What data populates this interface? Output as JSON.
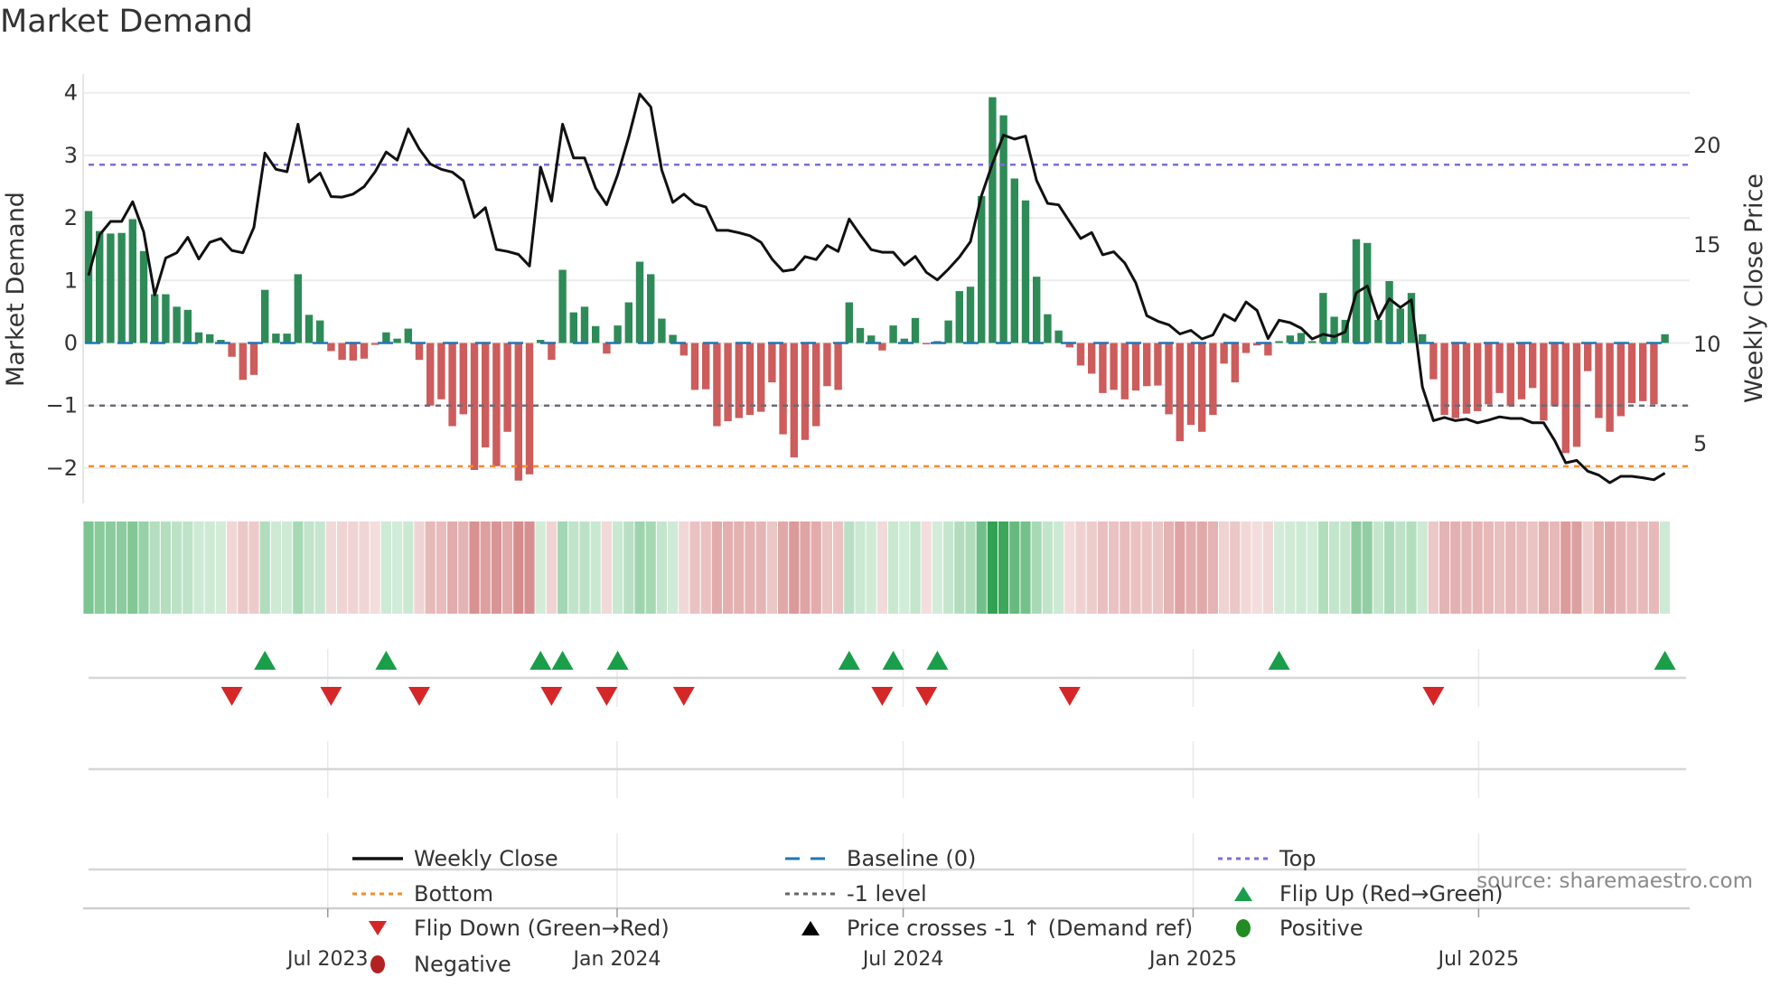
{
  "title": "Market Demand",
  "source": "source: sharemaestro.com",
  "legend": {
    "items": [
      {
        "label": "Weekly Close",
        "symbol": "line-solid",
        "color": "#111111"
      },
      {
        "label": "Baseline (0)",
        "symbol": "line-dashed",
        "color": "#1f77b4"
      },
      {
        "label": "Top",
        "symbol": "line-dotted",
        "color": "#7b6fd8"
      },
      {
        "label": "Bottom",
        "symbol": "line-dotted",
        "color": "#f28e2b"
      },
      {
        "label": "-1 level",
        "symbol": "line-dotted",
        "color": "#666666"
      },
      {
        "label": "Flip Up (Red→Green)",
        "symbol": "triangle-up",
        "color": "#1a9e4a"
      },
      {
        "label": "Flip Down (Green→Red)",
        "symbol": "triangle-down",
        "color": "#d62728"
      },
      {
        "label": "Price crosses -1 ↑ (Demand ref)",
        "symbol": "triangle-up",
        "color": "#000000"
      },
      {
        "label": "Positive",
        "symbol": "circle",
        "color": "#228b22"
      },
      {
        "label": "Negative",
        "symbol": "circle",
        "color": "#b22222"
      }
    ]
  },
  "chart_data": {
    "type": "bar+line",
    "title": "Market Demand",
    "ylabel": "Market Demand",
    "y2label": "Weekly Close Price",
    "ylim": [
      -2.5,
      4.2
    ],
    "y2lim": [
      2.7,
      24.5
    ],
    "yticks": [
      {
        "v": 4,
        "label": "4"
      },
      {
        "v": 3,
        "label": "3"
      },
      {
        "v": 2,
        "label": "2"
      },
      {
        "v": 1,
        "label": "1"
      },
      {
        "v": 0,
        "label": "0"
      },
      {
        "v": -1,
        "label": "−1"
      },
      {
        "v": -2,
        "label": "−2"
      }
    ],
    "y2ticks": [
      {
        "v": 20,
        "label": "20"
      },
      {
        "v": 15,
        "label": "15"
      },
      {
        "v": 10,
        "label": "10"
      },
      {
        "v": 5,
        "label": "5"
      }
    ],
    "xticks": [
      {
        "at_week": 21.7,
        "label": "Jul 2023"
      },
      {
        "at_week": 47.95,
        "label": "Jan 2024"
      },
      {
        "at_week": 73.9,
        "label": "Jul 2024"
      },
      {
        "at_week": 100.2,
        "label": "Jan 2025"
      },
      {
        "at_week": 126.1,
        "label": "Jul 2025"
      }
    ],
    "reference_lines": {
      "top": 2.85,
      "bottom": -1.97,
      "minus_one": -1,
      "baseline": 0
    },
    "colors": {
      "positive": "#2e8b57",
      "negative": "#cd5c5c",
      "price": "#111111",
      "flip_up": "#1a9e4a",
      "flip_down": "#d62728"
    },
    "demand": [
      2.11,
      1.79,
      1.75,
      1.76,
      1.98,
      1.47,
      0.78,
      0.78,
      0.58,
      0.53,
      0.17,
      0.14,
      0.05,
      -0.22,
      -0.59,
      -0.51,
      0.85,
      0.15,
      0.15,
      1.1,
      0.45,
      0.36,
      -0.13,
      -0.27,
      -0.28,
      -0.25,
      -0.03,
      0.17,
      0.07,
      0.23,
      -0.27,
      -1.0,
      -0.9,
      -1.33,
      -1.14,
      -2.03,
      -1.67,
      -1.97,
      -1.42,
      -2.2,
      -2.1,
      0.05,
      -0.27,
      1.17,
      0.49,
      0.58,
      0.27,
      -0.17,
      0.28,
      0.65,
      1.3,
      1.1,
      0.39,
      0.13,
      -0.2,
      -0.75,
      -0.74,
      -1.33,
      -1.25,
      -1.2,
      -1.15,
      -1.1,
      -0.63,
      -1.46,
      -1.83,
      -1.55,
      -1.33,
      -0.69,
      -0.75,
      0.65,
      0.24,
      0.12,
      -0.12,
      0.28,
      0.07,
      0.4,
      -0.02,
      0.03,
      0.36,
      0.83,
      0.9,
      2.35,
      3.93,
      3.64,
      2.63,
      2.28,
      1.06,
      0.46,
      0.2,
      -0.07,
      -0.36,
      -0.49,
      -0.8,
      -0.75,
      -0.9,
      -0.76,
      -0.69,
      -0.68,
      -1.14,
      -1.57,
      -1.31,
      -1.42,
      -1.15,
      -0.33,
      -0.63,
      -0.16,
      -0.04,
      -0.2,
      0.03,
      0.12,
      0.16,
      0.03,
      0.8,
      0.42,
      0.37,
      1.66,
      1.6,
      0.37,
      0.99,
      0.55,
      0.8,
      0.14,
      -0.58,
      -1.15,
      -1.2,
      -1.13,
      -1.09,
      -0.98,
      -0.8,
      -1.01,
      -0.9,
      -0.72,
      -1.24,
      -1.01,
      -1.76,
      -1.66,
      -0.45,
      -1.2,
      -1.42,
      -1.17,
      -0.96,
      -0.93,
      -0.98,
      0.14
    ],
    "weekly_close": [
      14.19,
      16.23,
      16.91,
      16.91,
      17.9,
      16.38,
      13.21,
      15.07,
      15.33,
      16.11,
      15.02,
      15.86,
      16.05,
      15.45,
      15.33,
      16.61,
      20.35,
      19.53,
      19.41,
      21.8,
      18.89,
      19.34,
      18.16,
      18.13,
      18.28,
      18.66,
      19.41,
      20.4,
      19.99,
      21.56,
      20.55,
      19.8,
      19.53,
      19.39,
      18.96,
      17.11,
      17.6,
      15.5,
      15.4,
      15.25,
      14.67,
      19.64,
      17.93,
      21.8,
      20.1,
      20.1,
      18.58,
      17.75,
      19.26,
      21.15,
      23.32,
      22.67,
      19.49,
      17.87,
      18.28,
      17.8,
      17.63,
      16.46,
      16.46,
      16.34,
      16.19,
      15.86,
      15.02,
      14.41,
      14.49,
      15.14,
      14.99,
      15.7,
      15.4,
      17.03,
      16.23,
      15.49,
      15.36,
      15.36,
      14.72,
      15.15,
      14.35,
      13.97,
      14.51,
      15.12,
      15.89,
      18.2,
      19.82,
      21.25,
      21.05,
      21.2,
      18.97,
      17.82,
      17.74,
      16.89,
      16.05,
      16.35,
      15.23,
      15.38,
      14.82,
      13.82,
      12.17,
      11.89,
      11.71,
      11.25,
      11.43,
      11.0,
      11.2,
      12.23,
      11.92,
      12.86,
      12.43,
      11.02,
      11.94,
      11.82,
      11.54,
      11.0,
      11.23,
      11.12,
      11.35,
      13.32,
      13.66,
      12.0,
      13.02,
      12.58,
      12.97,
      8.58,
      6.89,
      7.05,
      6.89,
      6.97,
      6.78,
      6.92,
      7.08,
      7.0,
      7.0,
      6.78,
      6.78,
      5.89,
      4.77,
      4.89,
      4.35,
      4.15,
      3.77,
      4.09,
      4.09,
      4.02,
      3.92,
      4.25
    ]
  }
}
